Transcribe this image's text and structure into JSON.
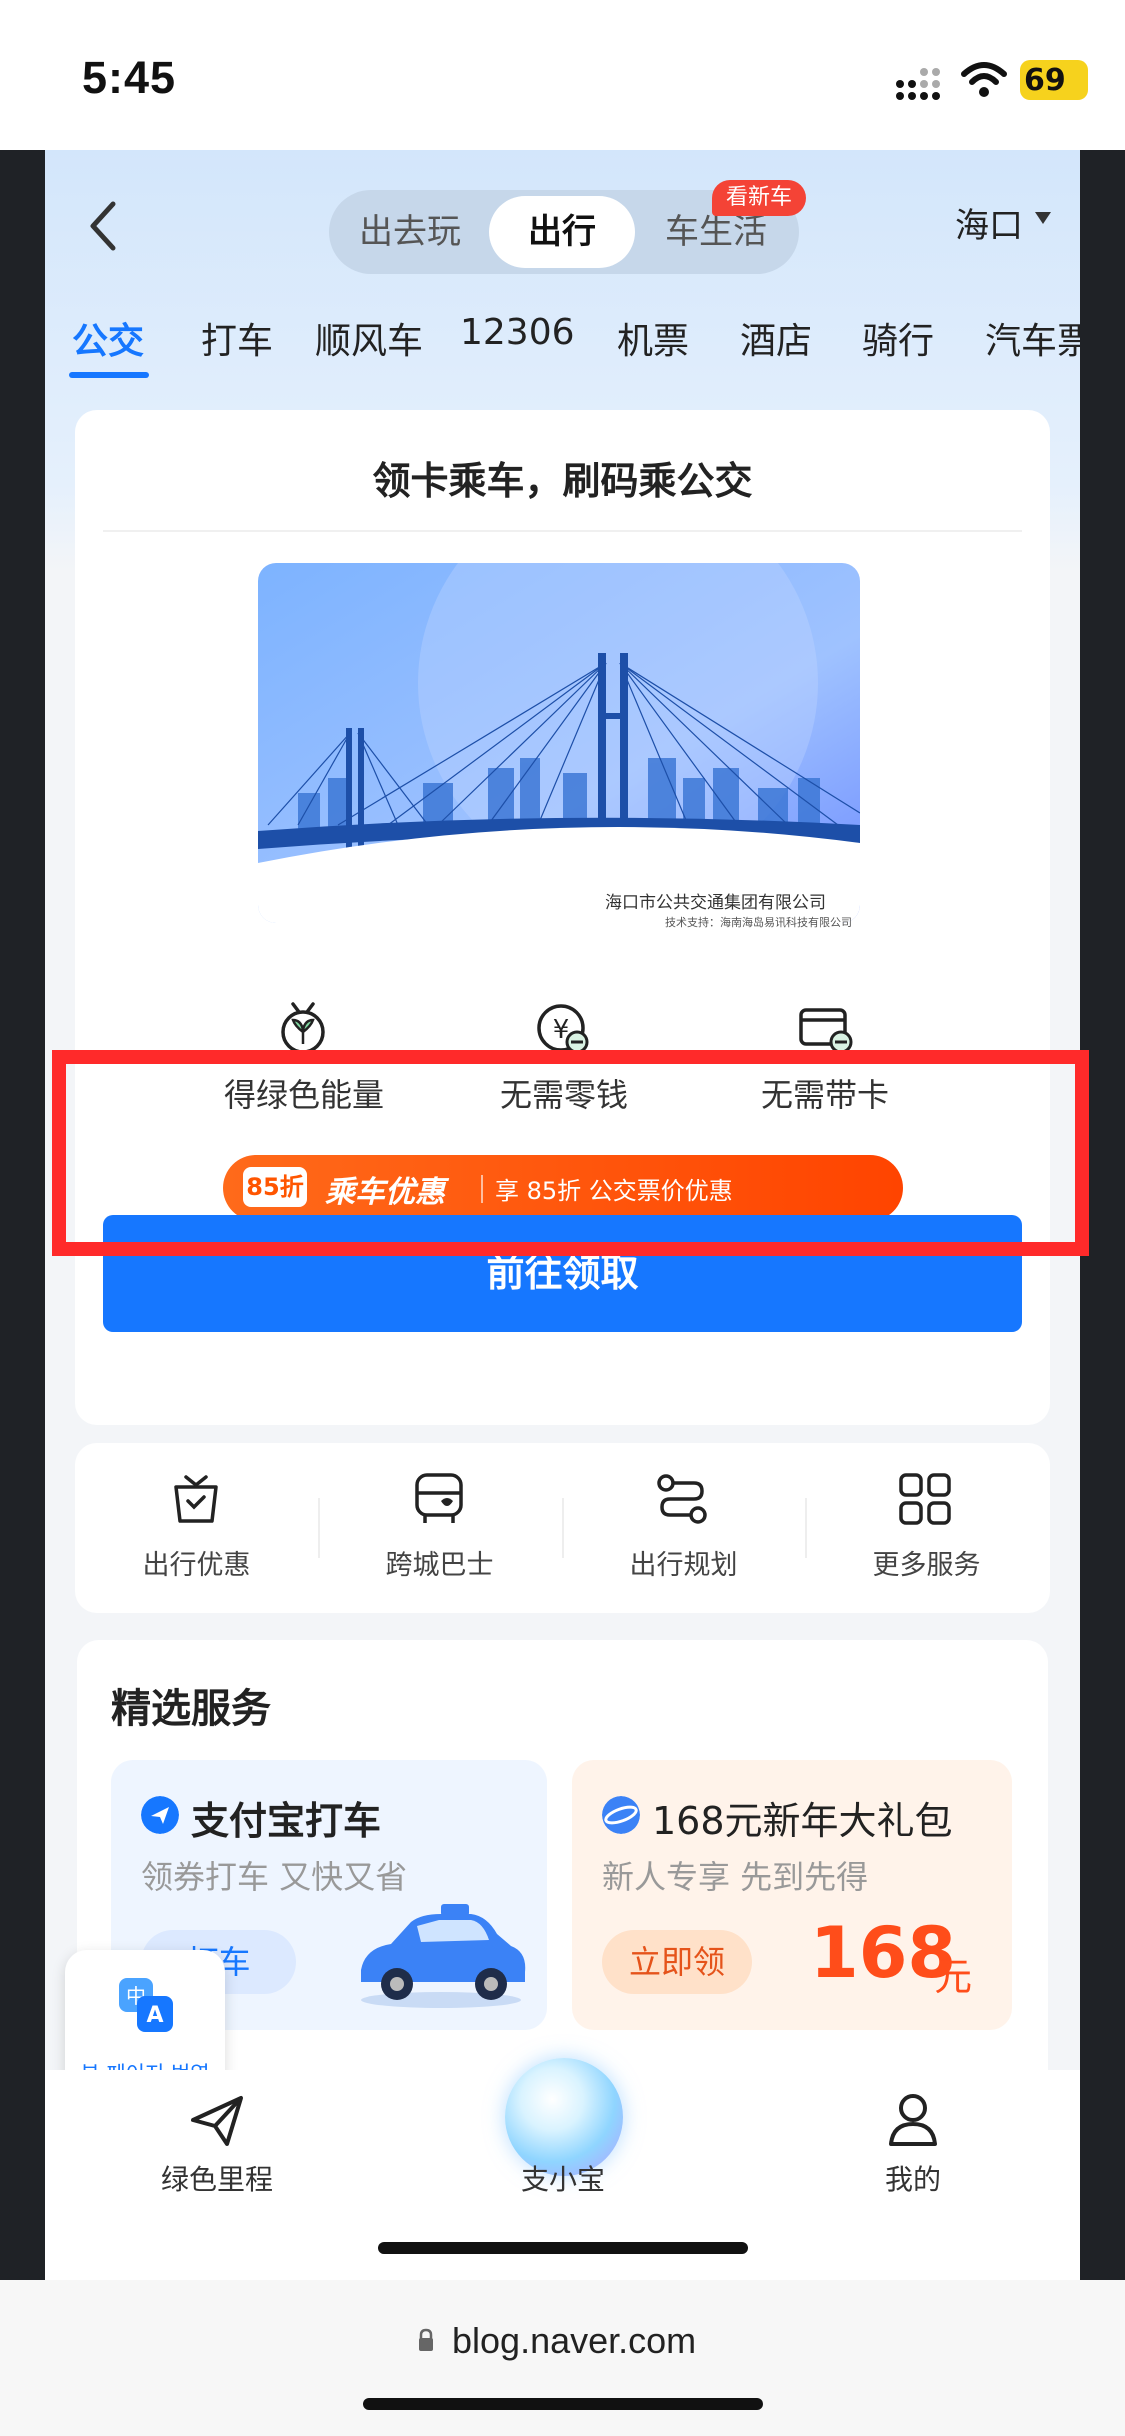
{
  "status_bar": {
    "time": "5:45",
    "battery": "69"
  },
  "header": {
    "segments": [
      "出去玩",
      "出行",
      "车生活"
    ],
    "active_segment": "出行",
    "segment_badge": "看新车",
    "city": "海口"
  },
  "tabs": [
    "公交",
    "打车",
    "顺风车",
    "12306",
    "机票",
    "酒店",
    "骑行",
    "汽车票"
  ],
  "active_tab": "公交",
  "bus_card": {
    "title": "领卡乘车，刷码乘公交",
    "card_company": "海口市公共交通集团有限公司",
    "card_tech": "技术支持：海南海岛易讯科技有限公司",
    "features": [
      {
        "icon": "sprout-icon",
        "label": "得绿色能量"
      },
      {
        "icon": "coin-icon",
        "label": "无需零钱"
      },
      {
        "icon": "card-icon",
        "label": "无需带卡"
      }
    ],
    "promo": {
      "tag": "85折",
      "title": "乘车优惠",
      "text": "享 85折 公交票价优惠"
    },
    "cta": "前往领取"
  },
  "shortcuts": [
    {
      "icon": "coupon-bag-icon",
      "label": "出行优惠"
    },
    {
      "icon": "bus-icon",
      "label": "跨城巴士"
    },
    {
      "icon": "route-icon",
      "label": "出行规划"
    },
    {
      "icon": "grid-icon",
      "label": "更多服务"
    }
  ],
  "featured": {
    "title": "精选服务",
    "items": [
      {
        "title": "支付宝打车",
        "subtitle": "领券打车 又快又省",
        "button": "打车"
      },
      {
        "title": "168元新年大礼包",
        "subtitle": "新人专享 先到先得",
        "button": "立即领",
        "amount": "168",
        "unit": "元"
      }
    ]
  },
  "translate": {
    "label": "본 페이지 번역"
  },
  "bottom_nav": [
    {
      "icon": "paper-plane-icon",
      "label": "绿色里程"
    },
    {
      "icon": "orb-icon",
      "label": "支小宝"
    },
    {
      "icon": "user-icon",
      "label": "我的"
    }
  ],
  "browser": {
    "url": "blog.naver.com"
  },
  "colors": {
    "accent": "#1677ff",
    "promo": "#ff4d1a",
    "highlight": "#ff2a2a"
  }
}
